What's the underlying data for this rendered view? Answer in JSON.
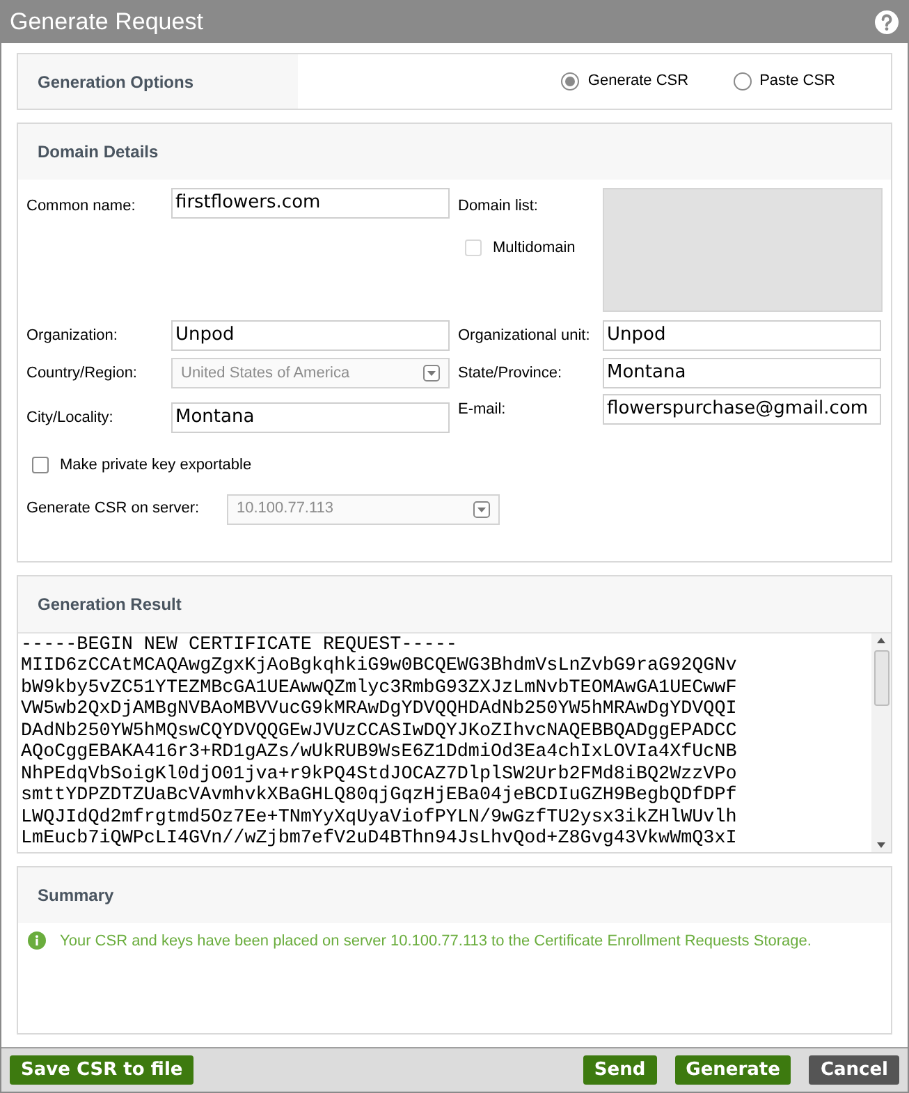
{
  "window": {
    "title": "Generate Request"
  },
  "generation_options": {
    "title": "Generation Options",
    "options": [
      {
        "label": "Generate CSR",
        "selected": true
      },
      {
        "label": "Paste CSR",
        "selected": false
      }
    ]
  },
  "domain_details": {
    "title": "Domain Details",
    "common_name": {
      "label": "Common name:",
      "value": "firstflowers.com"
    },
    "domain_list": {
      "label": "Domain list:"
    },
    "multidomain": {
      "label": "Multidomain",
      "checked": false
    },
    "organization": {
      "label": "Organization:",
      "value": "Unpod"
    },
    "organizational_unit": {
      "label": "Organizational unit:",
      "value": "Unpod"
    },
    "country": {
      "label": "Country/Region:",
      "value": "United States of America",
      "disabled": true
    },
    "state": {
      "label": "State/Province:",
      "value": "Montana"
    },
    "city": {
      "label": "City/Locality:",
      "value": "Montana"
    },
    "email": {
      "label": "E-mail:",
      "value": "flowerspurchase@gmail.com"
    },
    "exportable": {
      "label": "Make private key exportable",
      "checked": false
    },
    "server": {
      "label": "Generate CSR on server:",
      "value": "10.100.77.113",
      "disabled": true
    }
  },
  "generation_result": {
    "title": "Generation Result",
    "lines": [
      "-----BEGIN NEW CERTIFICATE REQUEST-----",
      "MIID6zCCAtMCAQAwgZgxKjAoBgkqhkiG9w0BCQEWG3BhdmVsLnZvbG9raG92QGNv",
      "bW9kby5vZC51YTEZMBcGA1UEAwwQZmlyc3RmbG93ZXJzLmNvbTEOMAwGA1UECwwF",
      "VW5wb2QxDjAMBgNVBAoMBVVucG9kMRAwDgYDVQQHDAdNb250YW5hMRAwDgYDVQQI",
      "DAdNb250YW5hMQswCQYDVQQGEwJVUzCCASIwDQYJKoZIhvcNAQEBBQADggEPADCC",
      "AQoCggEBAKA416r3+RD1gAZs/wUkRUB9WsE6Z1DdmiOd3Ea4chIxLOVIa4XfUcNB",
      "NhPEdqVbSoigKl0djO01jva+r9kPQ4StdJOCAZ7DlplSW2Urb2FMd8iBQ2WzzVPo",
      "smttYDPZDTZUaBcVAvmhvkXBaGHLQ80qjGqzHjEBa04jeBCDIuGZH9BegbQDfDPf",
      "LWQJIdQd2mfrgtmd5Oz7Ee+TNmYyXqUyaViofPYLN/9wGzfTU2ysx3ikZHlWUvlh",
      "LmEucb7iQWPcLI4GVn//wZjbm7efV2uD4BThn94JsLhvQod+Z8Gvg43VkwWmQ3xI"
    ]
  },
  "summary": {
    "title": "Summary",
    "message": "Your CSR and keys have been placed on server 10.100.77.113 to the Certificate Enrollment Requests Storage."
  },
  "footer": {
    "buttons": [
      {
        "label": "Save CSR to file",
        "kind": "primary"
      },
      {
        "label": "Send",
        "kind": "primary"
      },
      {
        "label": "Generate",
        "kind": "primary"
      },
      {
        "label": "Cancel",
        "kind": "secondary"
      }
    ]
  }
}
